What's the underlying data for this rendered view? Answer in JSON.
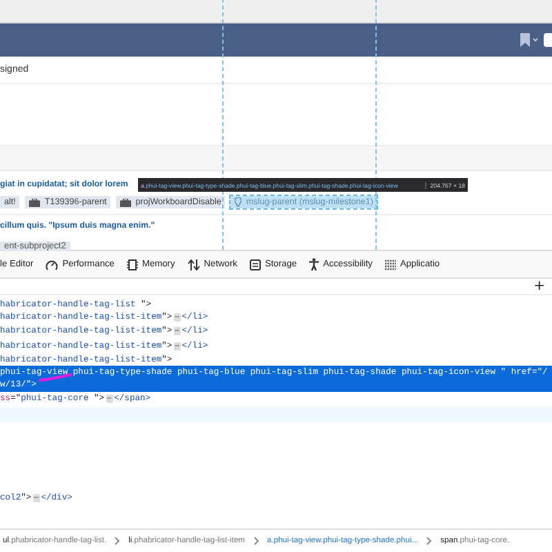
{
  "header": {
    "row_text": "signed"
  },
  "content": {
    "title": "giat in cupidatat; sit dolor lorem",
    "tags": [
      {
        "kind": "plain",
        "label": "alt!",
        "highlighted": false
      },
      {
        "kind": "project",
        "label": "T139396-parent",
        "highlighted": false
      },
      {
        "kind": "project",
        "label": "projWorkboardDisable",
        "highlighted": false
      },
      {
        "kind": "milestone",
        "label": "mslug-parent (mslug-milestone1)",
        "highlighted": true
      }
    ],
    "title2": "cillum quis. \"Ipsum duis magna enim.\"",
    "tag2": "ent-subproject2"
  },
  "tooltip": {
    "tag": "a",
    "selector": ".phui-tag-view.phui-tag-type-shade.phui-tag-blue.phui-tag-slim.phui-tag-shade.phui-tag-icon-view",
    "size": "204.767 × 18"
  },
  "devtools": {
    "tabs": [
      {
        "label": "le Editor"
      },
      {
        "label": "Performance"
      },
      {
        "label": "Memory"
      },
      {
        "label": "Network"
      },
      {
        "label": "Storage"
      },
      {
        "label": "Accessibility"
      },
      {
        "label": "Applicatio"
      }
    ],
    "add_button": "+",
    "lines": [
      {
        "selected": false,
        "segments": [
          {
            "kind": "value",
            "text": "habricator-handle-tag-list "
          },
          {
            "kind": "punct",
            "text": "\">"
          }
        ]
      },
      {
        "selected": false,
        "segments": [
          {
            "kind": "value",
            "text": "habricator-handle-tag-list-item"
          },
          {
            "kind": "punct",
            "text": "\">"
          },
          {
            "kind": "ellipsis",
            "text": "⋯"
          },
          {
            "kind": "tag",
            "text": "</li>"
          }
        ]
      },
      {
        "selected": false,
        "segments": [
          {
            "kind": "value",
            "text": "habricator-handle-tag-list-item"
          },
          {
            "kind": "punct",
            "text": "\">"
          },
          {
            "kind": "ellipsis",
            "text": "⋯"
          },
          {
            "kind": "tag",
            "text": "</li>"
          }
        ]
      },
      {
        "selected": false,
        "segments": [
          {
            "kind": "value",
            "text": "habricator-handle-tag-list-item"
          },
          {
            "kind": "punct",
            "text": "\">"
          },
          {
            "kind": "ellipsis",
            "text": "⋯"
          },
          {
            "kind": "tag",
            "text": "</li>"
          }
        ]
      },
      {
        "selected": false,
        "segments": [
          {
            "kind": "value",
            "text": "habricator-handle-tag-list-item"
          },
          {
            "kind": "punct",
            "text": "\">"
          }
        ]
      },
      {
        "selected": true,
        "segments": [
          {
            "kind": "value",
            "text": "phui-tag-view phui-tag-type-shade phui-tag-blue phui-tag-slim phui-tag-shade phui-tag-icon-view "
          },
          {
            "kind": "punct",
            "text": "\" "
          },
          {
            "kind": "attr",
            "text": "href"
          },
          {
            "kind": "punct",
            "text": "=\""
          },
          {
            "kind": "value",
            "text": "/w/13/"
          },
          {
            "kind": "punct",
            "text": "\">"
          }
        ]
      },
      {
        "selected": false,
        "segments": [
          {
            "kind": "attr",
            "text": "ss"
          },
          {
            "kind": "punct",
            "text": "=\""
          },
          {
            "kind": "value",
            "text": "phui-tag-core "
          },
          {
            "kind": "punct",
            "text": "\">"
          },
          {
            "kind": "ellipsis",
            "text": "⋯"
          },
          {
            "kind": "tag",
            "text": "</span>"
          }
        ]
      },
      {
        "selected": false,
        "segments": [
          {
            "kind": "value",
            "text": "col2"
          },
          {
            "kind": "punct",
            "text": "\">"
          },
          {
            "kind": "ellipsis",
            "text": "⋯"
          },
          {
            "kind": "tag",
            "text": "</div>"
          }
        ]
      }
    ],
    "breadcrumbs": [
      {
        "tag": "ul",
        "classes": ".phabricator-handle-tag-list.",
        "selected": false
      },
      {
        "tag": "li",
        "classes": ".phabricator-handle-tag-list-item",
        "selected": false
      },
      {
        "tag": "a",
        "classes": ".phui-tag-view.phui-tag-type-shade.phui...",
        "selected": true
      },
      {
        "tag": "span",
        "classes": ".phui-tag-core.",
        "selected": false
      }
    ]
  }
}
